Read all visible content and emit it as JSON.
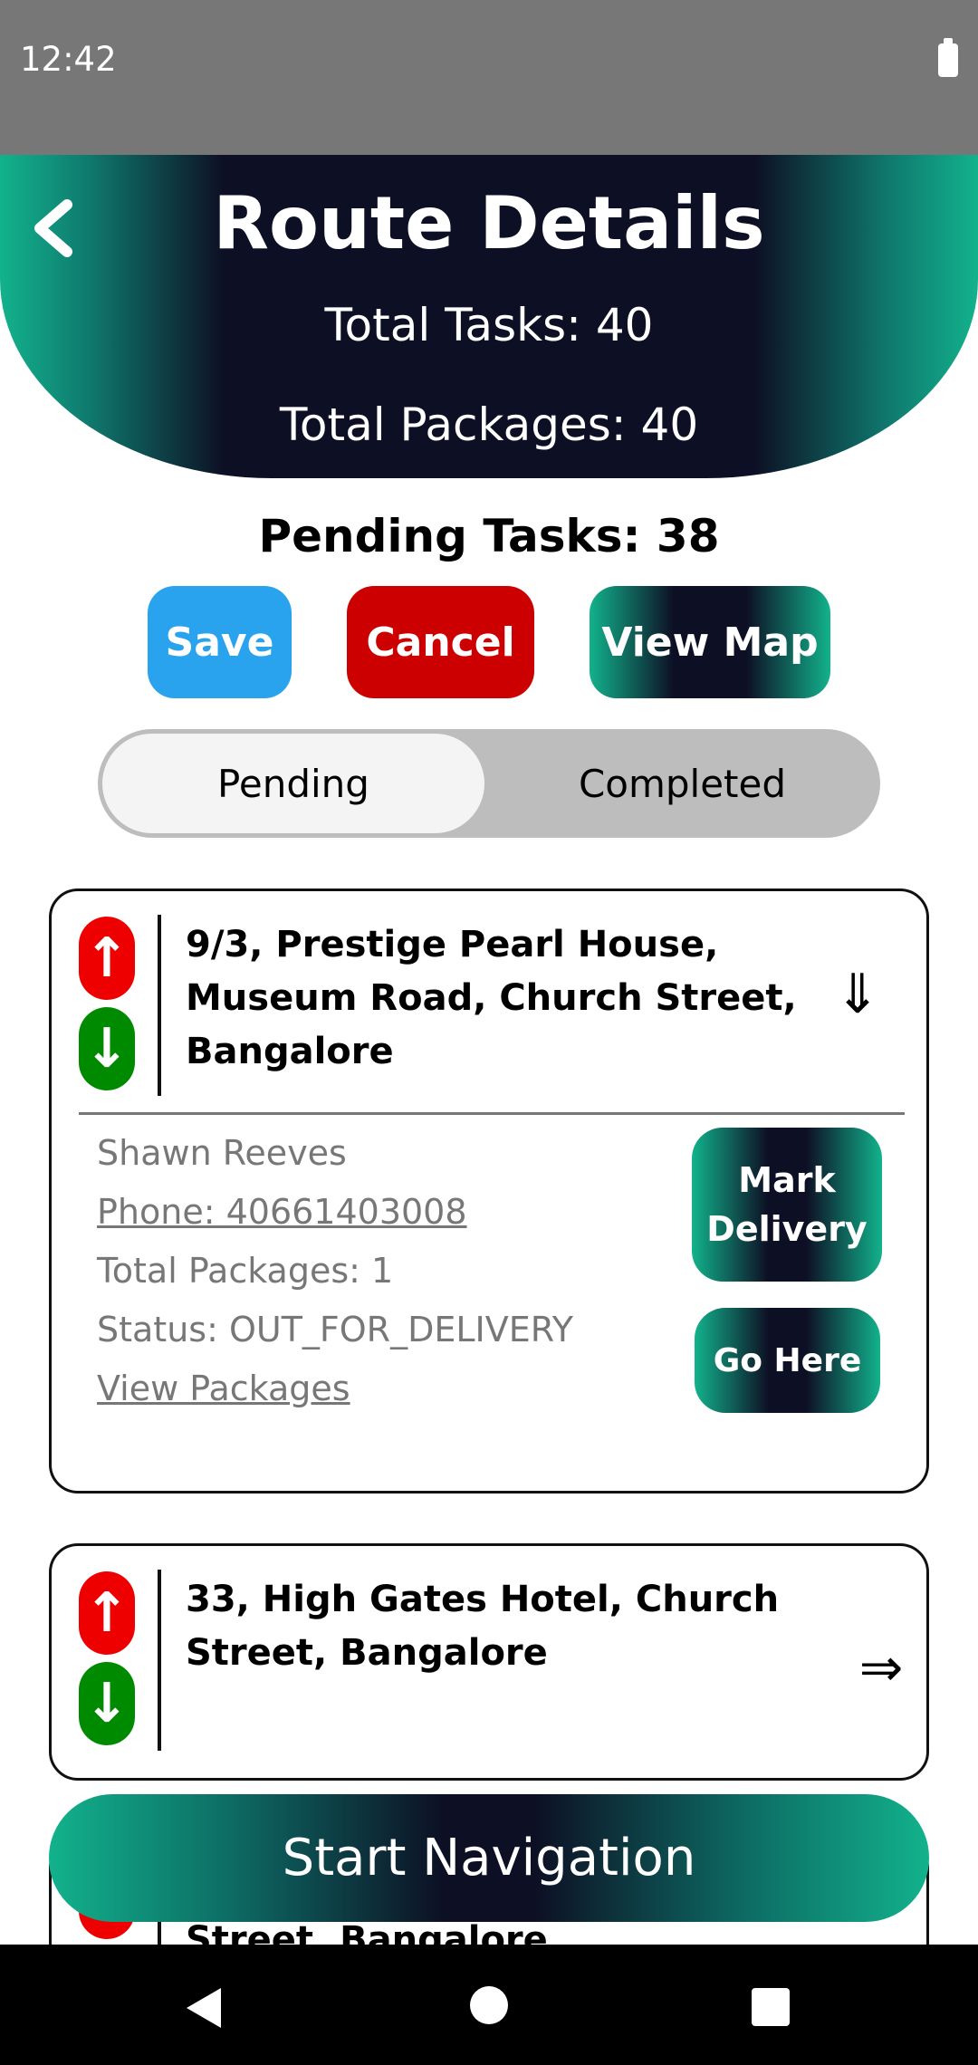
{
  "status_bar": {
    "time": "12:42",
    "battery_icon": "battery-icon"
  },
  "header": {
    "title": "Route Details",
    "total_tasks": "Total Tasks: 40",
    "total_packages": "Total Packages: 40",
    "back_icon": "chevron-left-icon"
  },
  "pending_tasks": "Pending Tasks: 38",
  "actions": {
    "save": "Save",
    "cancel": "Cancel",
    "view_map": "View Map"
  },
  "tabs": {
    "pending": "Pending",
    "completed": "Completed",
    "selected": "Pending"
  },
  "tasks": [
    {
      "address": "9/3, Prestige Pearl House, Museum Road, Church Street, Bangalore",
      "up_arrow": "↑",
      "down_arrow": "↓",
      "toggle_icon": "⇓",
      "expanded": true,
      "name": "Shawn Reeves",
      "phone": "Phone: 40661403008",
      "total_packages": "Total Packages: 1",
      "status": "Status: OUT_FOR_DELIVERY",
      "view_packages": "View Packages",
      "mark_delivery": "Mark Delivery",
      "go_here": "Go Here"
    },
    {
      "address": "33, High Gates Hotel, Church Street, Bangalore",
      "up_arrow": "↑",
      "down_arrow": "↓",
      "toggle_icon": "⇒",
      "expanded": false
    },
    {
      "address": "Street, Bangalore",
      "up_arrow": "↑",
      "toggle_icon": "›",
      "expanded": false
    }
  ],
  "start_navigation": "Start Navigation",
  "colors": {
    "header_dark": "#0d0f24",
    "accent_teal": "#12b28c",
    "save_blue": "#29a3ee",
    "cancel_red": "#cc0000",
    "up_red": "#ee0000",
    "down_green": "#008a00"
  }
}
